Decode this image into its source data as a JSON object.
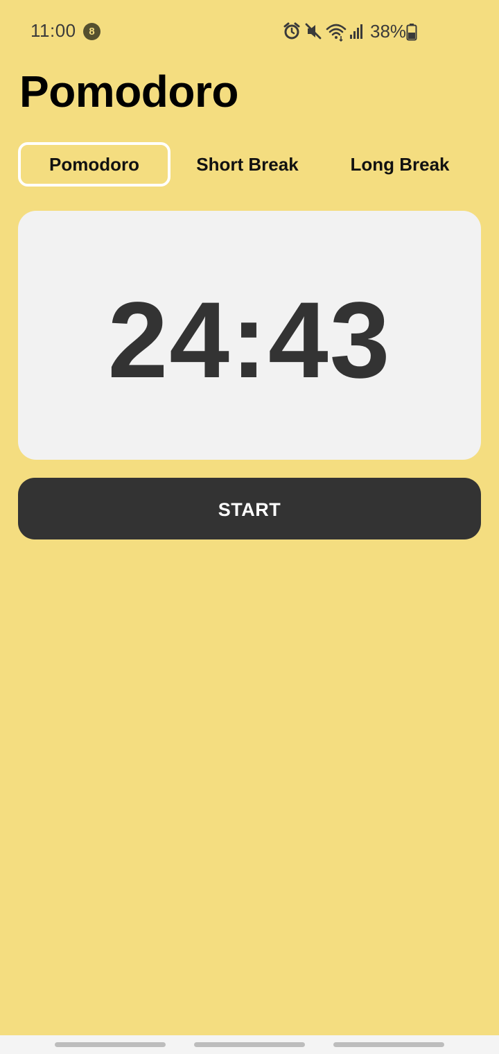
{
  "status_bar": {
    "time": "11:00",
    "notification_count": "8",
    "battery": "38%",
    "icons": [
      "alarm-icon",
      "mute-icon",
      "wifi-icon",
      "signal-icon",
      "battery-icon"
    ]
  },
  "page": {
    "title": "Pomodoro"
  },
  "tabs": [
    {
      "label": "Pomodoro",
      "active": true
    },
    {
      "label": "Short Break",
      "active": false
    },
    {
      "label": "Long Break",
      "active": false
    }
  ],
  "timer": {
    "display": "24:43"
  },
  "controls": {
    "start_label": "START"
  },
  "colors": {
    "background": "#f4dd80",
    "card": "#f2f2f2",
    "text_dark": "#333333",
    "active_tab_border": "#ffffff"
  }
}
